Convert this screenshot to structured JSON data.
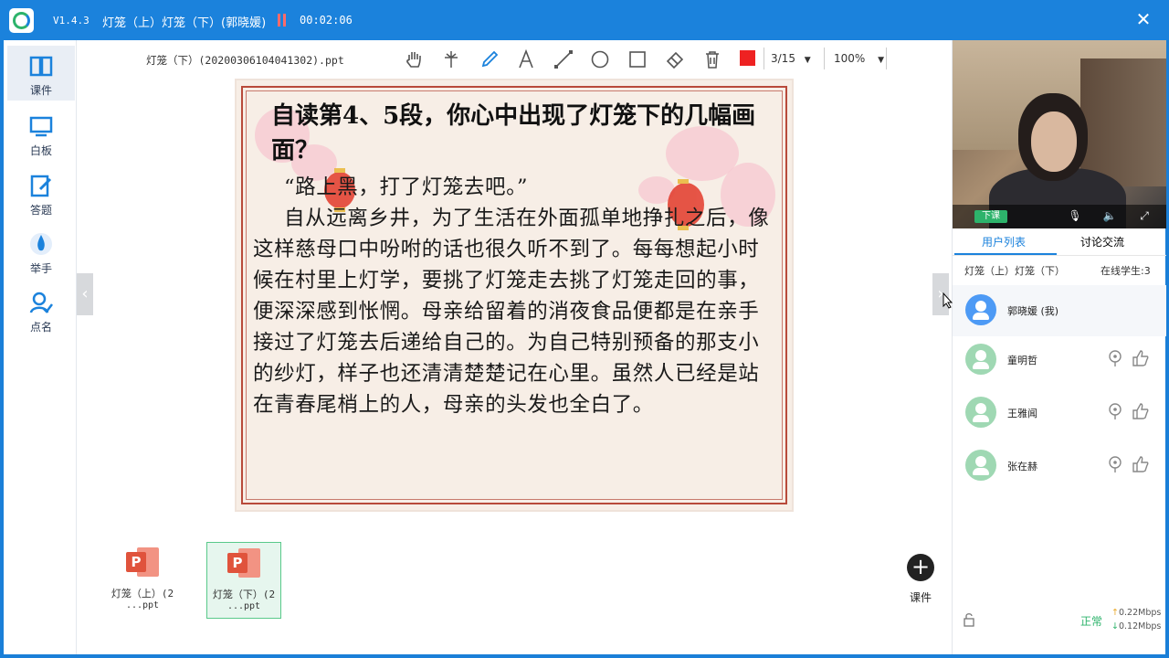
{
  "app": {
    "version": "V1.4.3",
    "course_title": "灯笼（上）灯笼（下）(郭晓媛)",
    "timer": "00:02:06"
  },
  "sidebar": {
    "items": [
      {
        "label": "课件",
        "icon": "book-icon"
      },
      {
        "label": "白板",
        "icon": "whiteboard-icon"
      },
      {
        "label": "答题",
        "icon": "answer-icon"
      },
      {
        "label": "举手",
        "icon": "raise-hand-icon"
      },
      {
        "label": "点名",
        "icon": "roll-call-icon"
      }
    ]
  },
  "toolbar": {
    "file_name": "灯笼（下）(20200306104041302).ppt",
    "tools": [
      "hand-icon",
      "laser-pointer-icon",
      "pen-icon",
      "text-icon",
      "line-icon",
      "circle-icon",
      "rectangle-icon",
      "eraser-icon",
      "trash-icon"
    ],
    "color": "#ee2222",
    "page": "3/15",
    "zoom": "100%"
  },
  "slide": {
    "title": "自读第4、5段，你心中出现了灯笼下的几幅画面？",
    "quote": "“路上黑，打了灯笼去吧。”",
    "paragraph": "自从远离乡井，为了生活在外面孤单地挣扎之后，像这样慈母口中吩咐的话也很久听不到了。每每想起小时候在村里上灯学，要挑了灯笼走去挑了灯笼走回的事，便深深感到怅惘。母亲给留着的消夜食品便都是在亲手接过了灯笼去后递给自己的。为自己特别预备的那支小的纱灯，样子也还清清楚楚记在心里。虽然人已经是站在青春尾梢上的人，母亲的头发也全白了。"
  },
  "thumbnails": [
    {
      "line1": "灯笼（上）(2",
      "line2": "...ppt",
      "selected": false
    },
    {
      "line1": "灯笼（下）(2",
      "line2": "...ppt",
      "selected": true
    }
  ],
  "add_courseware_label": "课件",
  "video": {
    "end_class_label": "下课"
  },
  "right_panel": {
    "tabs": [
      "用户列表",
      "讨论交流"
    ],
    "course": "灯笼（上）灯笼（下）",
    "online": "在线学生:3",
    "users": [
      {
        "name": "郭晓媛 (我)",
        "me": true
      },
      {
        "name": "童明哲",
        "me": false
      },
      {
        "name": "王雅闻",
        "me": false
      },
      {
        "name": "张在赫",
        "me": false
      }
    ],
    "status": "正常",
    "upload": "0.22Mbps",
    "download": "0.12Mbps"
  },
  "colors": {
    "brand": "#1b82dc",
    "accent_green": "#2db36b",
    "slide_border": "#b84a3a"
  }
}
